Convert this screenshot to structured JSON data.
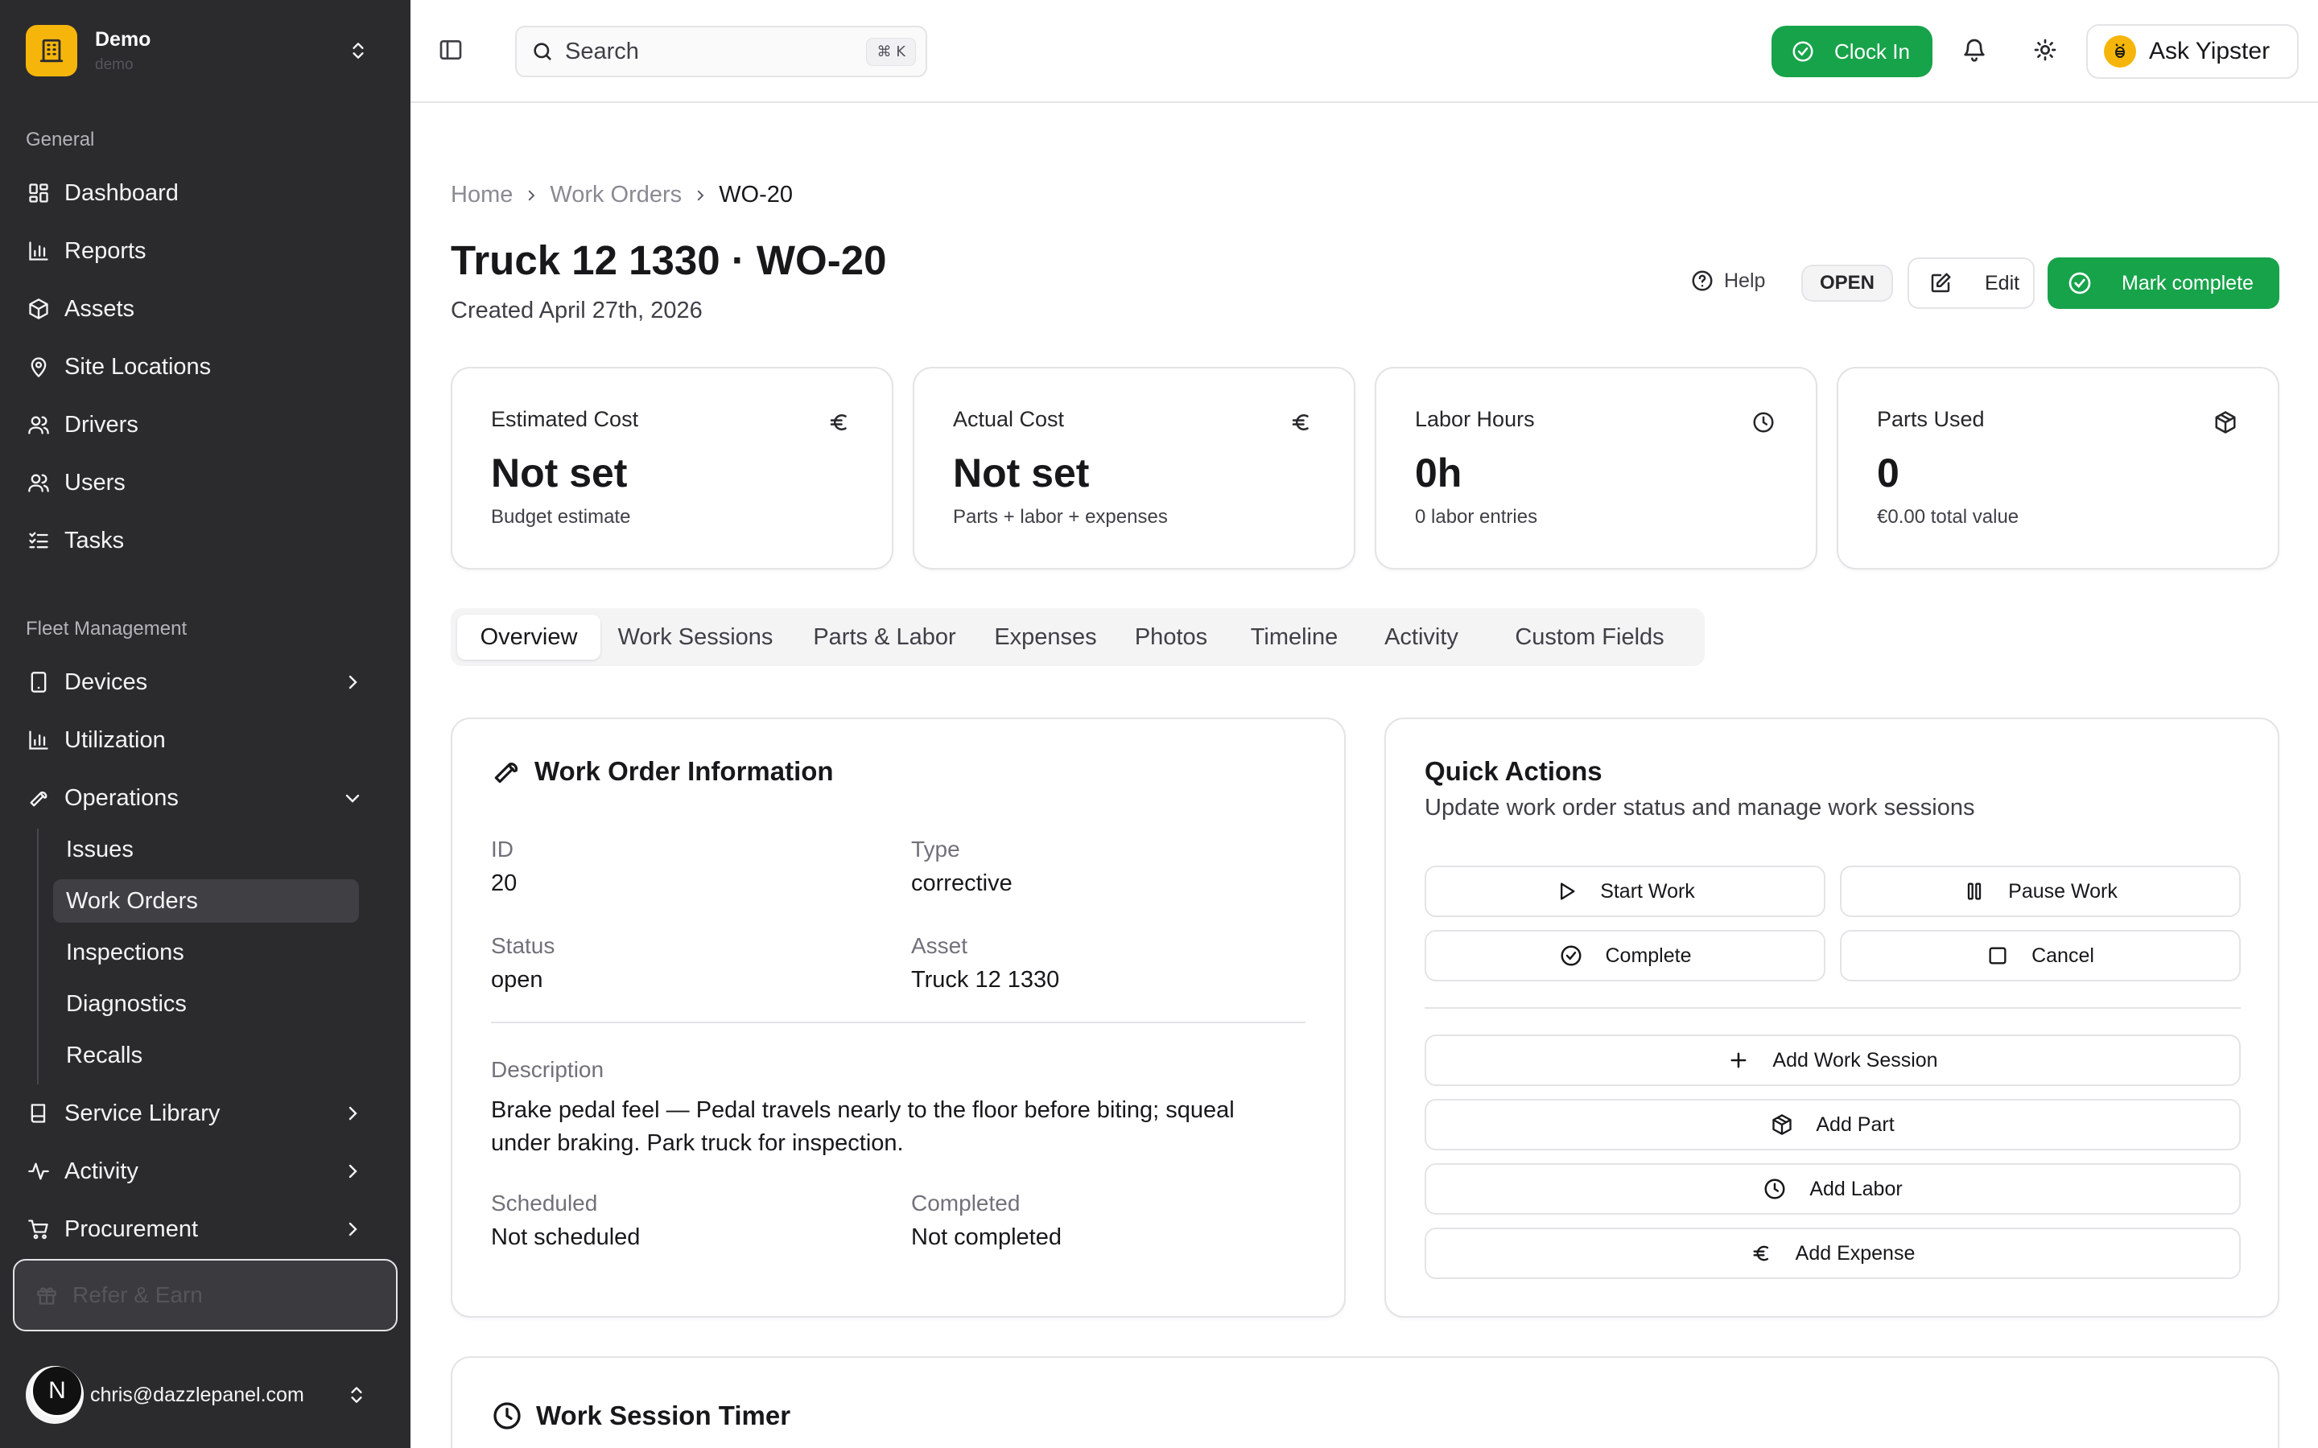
{
  "workspace": {
    "name": "Demo",
    "sub": "demo"
  },
  "sidebar": {
    "general_label": "General",
    "general": [
      {
        "label": "Dashboard",
        "icon": "dashboard-icon"
      },
      {
        "label": "Reports",
        "icon": "bar-chart-icon"
      },
      {
        "label": "Assets",
        "icon": "box-icon"
      },
      {
        "label": "Site Locations",
        "icon": "map-pin-icon"
      },
      {
        "label": "Drivers",
        "icon": "users-icon"
      },
      {
        "label": "Users",
        "icon": "users-icon"
      },
      {
        "label": "Tasks",
        "icon": "list-checks-icon"
      }
    ],
    "fleet_label": "Fleet Management",
    "fleet": [
      {
        "label": "Devices",
        "icon": "tablet-icon"
      },
      {
        "label": "Utilization",
        "icon": "bar-chart-icon"
      },
      {
        "label": "Operations",
        "icon": "wrench-icon"
      }
    ],
    "operations_sub": [
      "Issues",
      "Work Orders",
      "Inspections",
      "Diagnostics",
      "Recalls"
    ],
    "more": [
      {
        "label": "Service Library",
        "icon": "book-icon"
      },
      {
        "label": "Activity",
        "icon": "activity-icon"
      },
      {
        "label": "Procurement",
        "icon": "cart-icon"
      }
    ],
    "refer": "Refer & Earn",
    "user_initial": "N",
    "user_email": "chris@dazzlepanel.com"
  },
  "topbar": {
    "search_placeholder": "Search",
    "search_kbd": "⌘ K",
    "clock_in": "Clock In",
    "ask": "Ask Yipster"
  },
  "breadcrumb": [
    "Home",
    "Work Orders",
    "WO-20"
  ],
  "page": {
    "title": "Truck 12 1330 · WO-20",
    "created": "Created April 27th, 2026",
    "help": "Help",
    "status": "OPEN",
    "edit": "Edit",
    "mark_complete": "Mark complete"
  },
  "stats": [
    {
      "label": "Estimated Cost",
      "value": "Not set",
      "sub": "Budget estimate",
      "icon": "euro-icon"
    },
    {
      "label": "Actual Cost",
      "value": "Not set",
      "sub": "Parts + labor + expenses",
      "icon": "euro-icon"
    },
    {
      "label": "Labor Hours",
      "value": "0h",
      "sub": "0 labor entries",
      "icon": "clock-icon"
    },
    {
      "label": "Parts Used",
      "value": "0",
      "sub": "€0.00 total value",
      "icon": "package-icon"
    }
  ],
  "tabs": [
    "Overview",
    "Work Sessions",
    "Parts & Labor",
    "Expenses",
    "Photos",
    "Timeline",
    "Activity",
    "Custom Fields"
  ],
  "info": {
    "title": "Work Order Information",
    "id_label": "ID",
    "id": "20",
    "type_label": "Type",
    "type": "corrective",
    "status_label": "Status",
    "status": "open",
    "asset_label": "Asset",
    "asset": "Truck 12 1330",
    "desc_label": "Description",
    "desc": "Brake pedal feel — Pedal travels nearly to the floor before biting; squeal under braking. Park truck for inspection.",
    "scheduled_label": "Scheduled",
    "scheduled": "Not scheduled",
    "completed_label": "Completed",
    "completed": "Not completed"
  },
  "quick": {
    "title": "Quick Actions",
    "sub": "Update work order status and manage work sessions",
    "start": "Start Work",
    "pause": "Pause Work",
    "complete": "Complete",
    "cancel": "Cancel",
    "add_session": "Add Work Session",
    "add_part": "Add Part",
    "add_labor": "Add Labor",
    "add_expense": "Add Expense"
  },
  "timer": {
    "title": "Work Session Timer"
  },
  "colors": {
    "sidebar": "#2b2b2e",
    "accent": "#17a34a",
    "brand": "#f5b50b"
  }
}
